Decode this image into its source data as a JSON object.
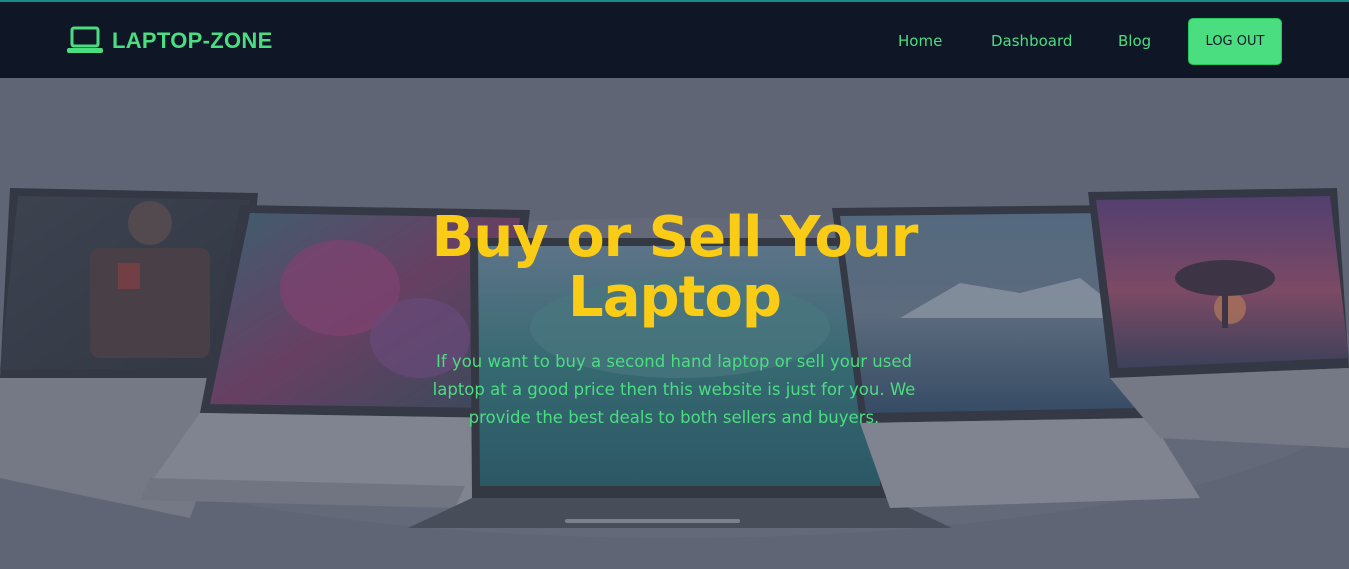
{
  "header": {
    "brand": "LAPTOP-ZONE",
    "brand_icon": "laptop-icon",
    "nav": {
      "home": "Home",
      "dashboard": "Dashboard",
      "blog": "Blog"
    },
    "logout_label": "LOG OUT"
  },
  "hero": {
    "title": "Buy or Sell Your Laptop",
    "description": "If you want to buy a second hand laptop or sell your used laptop at a good price then this website is just for you. We provide the best deals to both sellers and buyers."
  },
  "colors": {
    "navbar_bg": "#0f1726",
    "accent_green": "#4ade80",
    "title_yellow": "#facc15"
  }
}
